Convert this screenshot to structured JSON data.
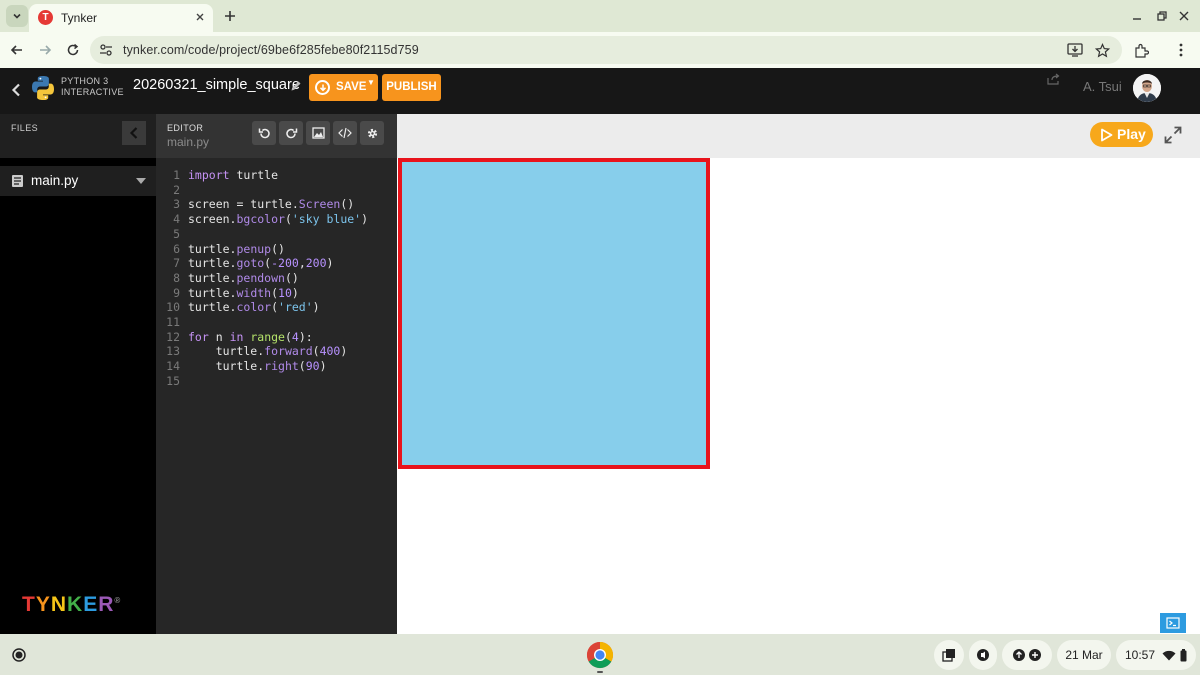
{
  "browser": {
    "tab": {
      "title": "Tynker",
      "favicon_letter": "T"
    },
    "url": "tynker.com/code/project/69be6f285febe80f2115d759",
    "icons": [
      "tab-search-icon",
      "close-icon",
      "plus-icon",
      "minimize-icon",
      "restore-icon",
      "close-window-icon",
      "back-arrow-icon",
      "forward-arrow-icon",
      "reload-icon",
      "site-info-icon",
      "install-app-icon",
      "bookmark-star-icon",
      "extensions-icon",
      "menu-kebab-icon"
    ]
  },
  "app": {
    "language_label": "PYTHON 3",
    "language_sub": "INTERACTIVE",
    "project_title": "20260321_simple_square",
    "save_label": "SAVE",
    "publish_label": "PUBLISH",
    "user_name": "A. Tsui",
    "accent": "#f7941d"
  },
  "files": {
    "header": "FILES",
    "items": [
      {
        "name": "main.py"
      }
    ],
    "logo": [
      "T",
      "Y",
      "N",
      "K",
      "E",
      "R"
    ]
  },
  "editor": {
    "header": "EDITOR",
    "file": "main.py",
    "tools": [
      "undo-icon",
      "redo-icon",
      "image-icon",
      "code-icon",
      "settings-gear-icon"
    ],
    "line_numbers": [
      "1",
      "2",
      "3",
      "4",
      "5",
      "6",
      "7",
      "8",
      "9",
      "10",
      "11",
      "12",
      "13",
      "14",
      "15"
    ],
    "code": {
      "l1a": "import",
      "l1b": " turtle",
      "l3a": "screen = turtle.",
      "l3b": "Screen",
      "l3c": "()",
      "l4a": "screen.",
      "l4b": "bgcolor",
      "l4c": "(",
      "l4d": "'sky blue'",
      "l4e": ")",
      "l6a": "turtle.",
      "l6b": "penup",
      "l6c": "()",
      "l7a": "turtle.",
      "l7b": "goto",
      "l7c": "(",
      "l7d": "-200",
      "l7e": ",",
      "l7f": "200",
      "l7g": ")",
      "l8a": "turtle.",
      "l8b": "pendown",
      "l8c": "()",
      "l9a": "turtle.",
      "l9b": "width",
      "l9c": "(",
      "l9d": "10",
      "l9e": ")",
      "l10a": "turtle.",
      "l10b": "color",
      "l10c": "(",
      "l10d": "'red'",
      "l10e": ")",
      "l12a": "for",
      "l12b": " n ",
      "l12c": "in",
      "l12d": " ",
      "l12e": "range",
      "l12f": "(",
      "l12g": "4",
      "l12h": "):",
      "l13a": "    turtle.",
      "l13b": "forward",
      "l13c": "(",
      "l13d": "400",
      "l13e": ")",
      "l14a": "    turtle.",
      "l14b": "right",
      "l14c": "(",
      "l14d": "90",
      "l14e": ")"
    }
  },
  "stage": {
    "play_label": "Play",
    "canvas_fill": "#87ceeb",
    "square_stroke": "#e8131b"
  },
  "shelf": {
    "date": "21 Mar",
    "time": "10:57"
  }
}
